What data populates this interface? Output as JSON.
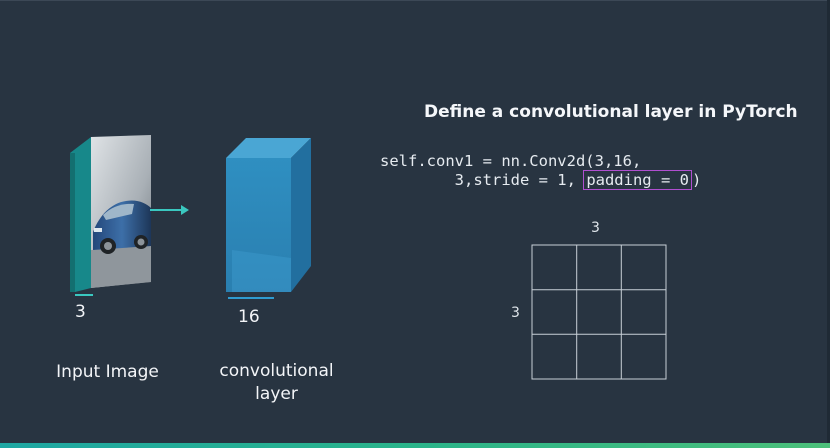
{
  "slide": {
    "title": "Define a convolutional layer in PyTorch",
    "code": {
      "line1": "self.conv1 = nn.Conv2d(3,16,",
      "line2_pre": "        3,stride = 1, ",
      "line2_highlight": "padding = 0",
      "line2_post": ")"
    },
    "input_image": {
      "depth_label": "3",
      "caption": "Input Image"
    },
    "conv_layer": {
      "depth_label": "16",
      "caption_line1": "convolutional",
      "caption_line2": "layer"
    },
    "kernel_grid": {
      "width_label": "3",
      "height_label": "3",
      "rows": 3,
      "cols": 3
    },
    "colors": {
      "background": "#283441",
      "highlight_box": "#b04fd0",
      "layer_blue": "#2d8ec0",
      "arrow_teal": "#3ac8c0"
    }
  }
}
